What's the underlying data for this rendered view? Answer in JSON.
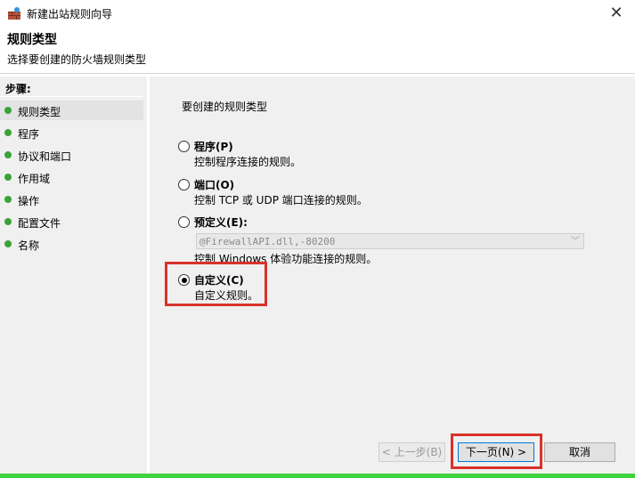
{
  "window": {
    "title": "新建出站规则向导"
  },
  "header": {
    "title": "规则类型",
    "subtitle": "选择要创建的防火墙规则类型"
  },
  "sidebar": {
    "steps_label": "步骤:",
    "items": [
      {
        "label": "规则类型"
      },
      {
        "label": "程序"
      },
      {
        "label": "协议和端口"
      },
      {
        "label": "作用域"
      },
      {
        "label": "操作"
      },
      {
        "label": "配置文件"
      },
      {
        "label": "名称"
      }
    ]
  },
  "main": {
    "question": "要创建的规则类型",
    "options": [
      {
        "title": "程序(P)",
        "desc": "控制程序连接的规则。"
      },
      {
        "title": "端口(O)",
        "desc": "控制 TCP 或 UDP 端口连接的规则。"
      },
      {
        "title": "预定义(E):",
        "desc": "控制 Windows 体验功能连接的规则。"
      },
      {
        "title": "自定义(C)",
        "desc": "自定义规则。"
      }
    ],
    "predefined_value": "@FirewallAPI.dll,-80200"
  },
  "buttons": {
    "back": "< 上一步(B)",
    "next": "下一页(N) >",
    "cancel": "取消"
  },
  "colors": {
    "accent": "#0078d7",
    "highlight": "#d9322a",
    "step_dot": "#3aa33a"
  }
}
